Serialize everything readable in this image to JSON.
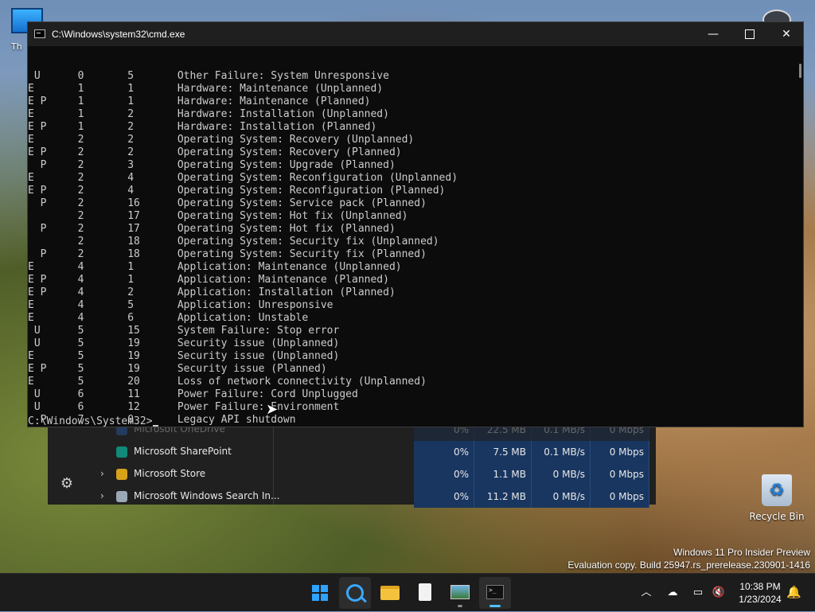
{
  "desktop": {
    "this_pc_label": "Th",
    "recycle_bin_label": "Recycle Bin",
    "watermark_line1": "Windows 11 Pro Insider Preview",
    "watermark_line2": "Evaluation copy. Build 25947.rs_prerelease.230901-1416"
  },
  "cmd": {
    "title": "C:\\Windows\\system32\\cmd.exe",
    "lines": [
      " U      0       5       Other Failure: System Unresponsive",
      "E       1       1       Hardware: Maintenance (Unplanned)",
      "E P     1       1       Hardware: Maintenance (Planned)",
      "E       1       2       Hardware: Installation (Unplanned)",
      "E P     1       2       Hardware: Installation (Planned)",
      "E       2       2       Operating System: Recovery (Unplanned)",
      "E P     2       2       Operating System: Recovery (Planned)",
      "  P     2       3       Operating System: Upgrade (Planned)",
      "E       2       4       Operating System: Reconfiguration (Unplanned)",
      "E P     2       4       Operating System: Reconfiguration (Planned)",
      "  P     2       16      Operating System: Service pack (Planned)",
      "        2       17      Operating System: Hot fix (Unplanned)",
      "  P     2       17      Operating System: Hot fix (Planned)",
      "        2       18      Operating System: Security fix (Unplanned)",
      "  P     2       18      Operating System: Security fix (Planned)",
      "E       4       1       Application: Maintenance (Unplanned)",
      "E P     4       1       Application: Maintenance (Planned)",
      "E P     4       2       Application: Installation (Planned)",
      "E       4       5       Application: Unresponsive",
      "E       4       6       Application: Unstable",
      " U      5       15      System Failure: Stop error",
      " U      5       19      Security issue (Unplanned)",
      "E       5       19      Security issue (Unplanned)",
      "E P     5       19      Security issue (Planned)",
      "E       5       20      Loss of network connectivity (Unplanned)",
      " U      6       11      Power Failure: Cord Unplugged",
      " U      6       12      Power Failure: Environment",
      "  P     7       0       Legacy API shutdown"
    ],
    "prompt": "C:\\Windows\\System32>"
  },
  "taskmgr": {
    "rows": [
      {
        "name": "Microsoft OneDrive",
        "cpu": "0%",
        "mem": "22.5 MB",
        "disk": "0.1 MB/s",
        "net": "0 Mbps",
        "icon_color": "#2d6fd0",
        "expandable": false,
        "faded": true
      },
      {
        "name": "Microsoft SharePoint",
        "cpu": "0%",
        "mem": "7.5 MB",
        "disk": "0.1 MB/s",
        "net": "0 Mbps",
        "icon_color": "#118a7a",
        "expandable": false,
        "faded": false
      },
      {
        "name": "Microsoft Store",
        "cpu": "0%",
        "mem": "1.1 MB",
        "disk": "0 MB/s",
        "net": "0 Mbps",
        "icon_color": "#d6a21a",
        "expandable": true,
        "faded": false
      },
      {
        "name": "Microsoft Windows Search In...",
        "cpu": "0%",
        "mem": "11.2 MB",
        "disk": "0 MB/s",
        "net": "0 Mbps",
        "icon_color": "#9aa7b5",
        "expandable": true,
        "faded": false
      }
    ]
  },
  "taskbar": {
    "time": "10:38 PM",
    "date": "1/23/2024"
  },
  "icons": {
    "start": "windows-logo",
    "search": "search",
    "explorer": "folder",
    "notepad": "notepad",
    "photos": "photos",
    "terminal": "terminal"
  }
}
